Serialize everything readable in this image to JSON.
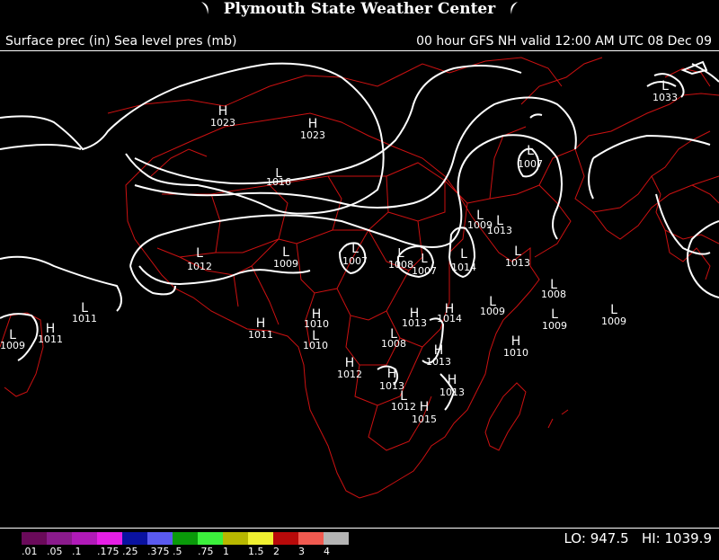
{
  "title": "Plymouth State Weather Center",
  "subtitle_left": "Surface prec (in) Sea level pres (mb)",
  "subtitle_right": "00 hour GFS NH valid 12:00 AM UTC 08 Dec 09",
  "colors": {
    "background": "#000000",
    "isobar": "#ffffff",
    "border": "#cc1111"
  },
  "legend": {
    "colors": [
      "#6a0a5a",
      "#8a1b8c",
      "#b01ab8",
      "#e61fe6",
      "#0a12a0",
      "#5a5af0",
      "#0a9a0a",
      "#3cf03c",
      "#b8b800",
      "#f0f030",
      "#b80a0a",
      "#f05a50",
      "#b4b4b4"
    ],
    "labels": [
      ".01",
      ".05",
      ".1",
      ".175",
      ".25",
      ".375",
      ".5",
      ".75",
      "1",
      "1.5",
      "2",
      "3",
      "4"
    ]
  },
  "lo_label": "LO:",
  "lo_value": "947.5",
  "hi_label": "HI:",
  "hi_value": "1039.9",
  "pressure_centers": [
    {
      "type": "H",
      "value": "1023"
    },
    {
      "type": "H",
      "value": "1023"
    },
    {
      "type": "L",
      "value": "1007"
    },
    {
      "type": "L",
      "value": "1016"
    },
    {
      "type": "L",
      "value": "1009"
    },
    {
      "type": "L",
      "value": "1013"
    },
    {
      "type": "L",
      "value": "1012"
    },
    {
      "type": "L",
      "value": "1009"
    },
    {
      "type": "L",
      "value": "1007"
    },
    {
      "type": "L",
      "value": "1008"
    },
    {
      "type": "L",
      "value": "1007"
    },
    {
      "type": "L",
      "value": "1014"
    },
    {
      "type": "L",
      "value": "1013"
    },
    {
      "type": "L",
      "value": "1011"
    },
    {
      "type": "H",
      "value": "1011"
    },
    {
      "type": "L",
      "value": "1009"
    },
    {
      "type": "H",
      "value": "1011"
    },
    {
      "type": "H",
      "value": "1010"
    },
    {
      "type": "L",
      "value": "1010"
    },
    {
      "type": "H",
      "value": "1013"
    },
    {
      "type": "H",
      "value": "1014"
    },
    {
      "type": "L",
      "value": "1008"
    },
    {
      "type": "L",
      "value": "1008"
    },
    {
      "type": "L",
      "value": "1009"
    },
    {
      "type": "L",
      "value": "1009"
    },
    {
      "type": "L",
      "value": "1009"
    },
    {
      "type": "H",
      "value": "1010"
    },
    {
      "type": "H",
      "value": "1012"
    },
    {
      "type": "H",
      "value": "1013"
    },
    {
      "type": "H",
      "value": "1013"
    },
    {
      "type": "H",
      "value": "1013"
    },
    {
      "type": "L",
      "value": "1012"
    },
    {
      "type": "H",
      "value": "1015"
    },
    {
      "type": "L",
      "value": "1033"
    }
  ]
}
